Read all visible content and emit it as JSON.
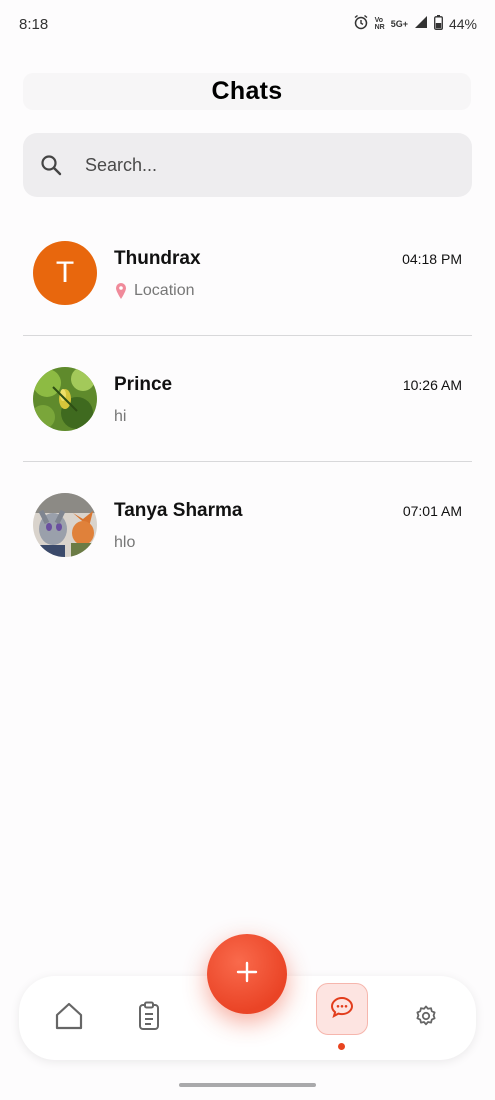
{
  "status_bar": {
    "time": "8:18",
    "network_top": "Vo",
    "network_bottom": "NR",
    "network_5g": "5G+",
    "battery": "44%"
  },
  "header": {
    "title": "Chats"
  },
  "search": {
    "placeholder": "Search..."
  },
  "chats": [
    {
      "name": "Thundrax",
      "time": "04:18 PM",
      "preview": "Location",
      "avatar_letter": "T",
      "avatar_color": "#e8670d"
    },
    {
      "name": "Prince",
      "time": "10:26 AM",
      "preview": "hi"
    },
    {
      "name": "Tanya Sharma",
      "time": "07:01 AM",
      "preview": "hlo"
    }
  ],
  "bottom_nav": {
    "items": [
      {
        "icon": "home-icon"
      },
      {
        "icon": "clipboard-icon"
      },
      {
        "icon": "chat-bubble-icon",
        "active": true
      },
      {
        "icon": "settings-gear-icon"
      }
    ],
    "accent_color": "#ea4426"
  },
  "fab": {
    "label": "+"
  }
}
